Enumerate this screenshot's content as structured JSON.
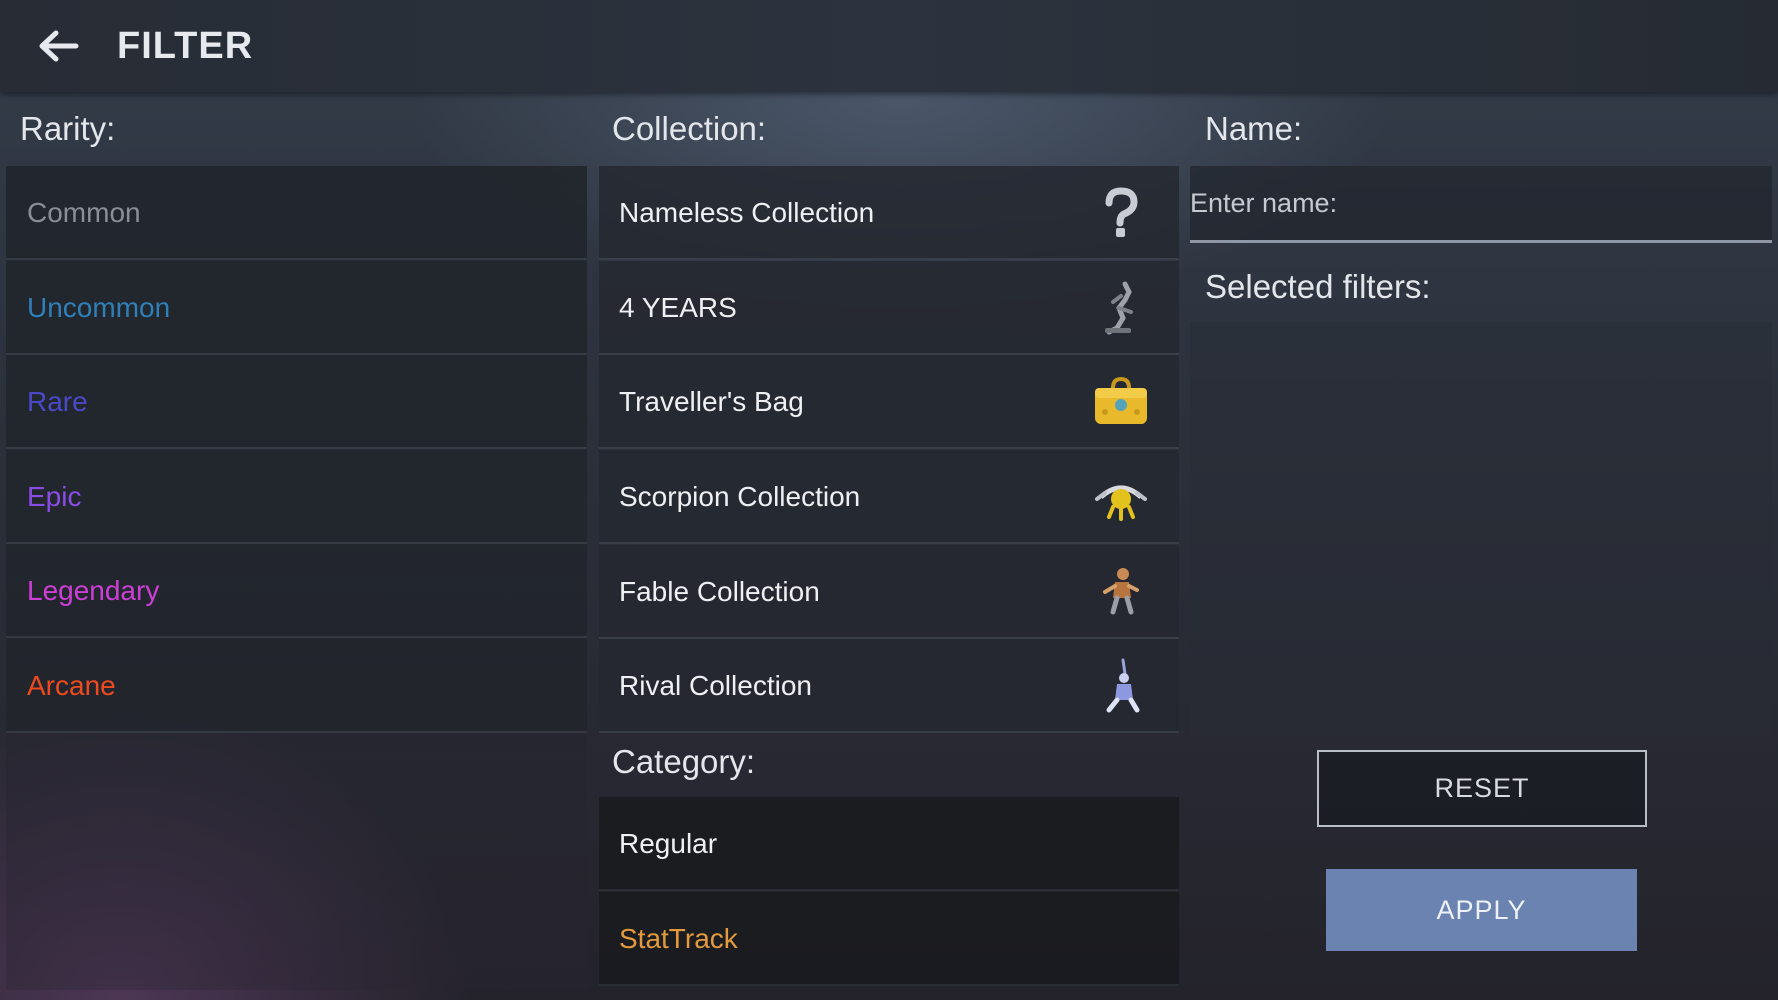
{
  "header": {
    "title": "FILTER",
    "back_icon": "arrow-left-icon"
  },
  "rarity": {
    "label": "Rarity:",
    "items": [
      {
        "label": "Common",
        "color": "#8a8e96"
      },
      {
        "label": "Uncommon",
        "color": "#2f7fb8"
      },
      {
        "label": "Rare",
        "color": "#4a49c6"
      },
      {
        "label": "Epic",
        "color": "#8b4ce6"
      },
      {
        "label": "Legendary",
        "color": "#cc3fd6"
      },
      {
        "label": "Arcane",
        "color": "#ee4a1f"
      }
    ]
  },
  "collection": {
    "label": "Collection:",
    "items": [
      {
        "label": "Nameless Collection",
        "icon": "question-mark-icon"
      },
      {
        "label": "4 YEARS",
        "icon": "gray-figure-icon"
      },
      {
        "label": "Traveller's Bag",
        "icon": "bag-icon"
      },
      {
        "label": "Scorpion Collection",
        "icon": "scorpion-icon"
      },
      {
        "label": "Fable Collection",
        "icon": "fable-figure-icon"
      },
      {
        "label": "Rival Collection",
        "icon": "rival-figure-icon"
      }
    ]
  },
  "category": {
    "label": "Category:",
    "items": [
      {
        "label": "Regular",
        "color": "#eef0f3"
      },
      {
        "label": "StatTrack",
        "color": "#e39a3c"
      }
    ]
  },
  "name": {
    "label": "Name:",
    "placeholder": "Enter name:",
    "value": ""
  },
  "selected_filters": {
    "label": "Selected filters:"
  },
  "buttons": {
    "reset": "RESET",
    "apply": "APPLY"
  }
}
